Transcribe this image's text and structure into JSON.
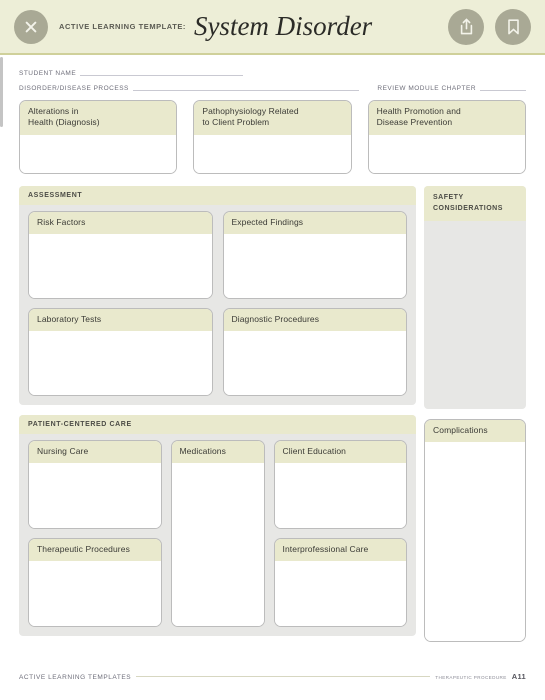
{
  "appbar": {
    "close_icon": "close-x-icon",
    "kicker": "ACTIVE LEARNING TEMPLATE:",
    "title": "System Disorder",
    "share_icon": "share-upload-icon",
    "bookmark_icon": "bookmark-icon",
    "background_color": "#edeed7",
    "button_color": "#a9a995",
    "rule_color": "#cfd09a"
  },
  "identity": {
    "student_name_label": "STUDENT NAME",
    "student_name_value": "",
    "student_name_placeholder": "",
    "disorder_label": "DISORDER/DISEASE PROCESS",
    "disorder_value": "",
    "disorder_placeholder": "",
    "chapter_label": "REVIEW MODULE CHAPTER",
    "chapter_value": "",
    "chapter_placeholder": ""
  },
  "top_boxes": [
    {
      "label": "Alterations in\nHealth (Diagnosis)",
      "value": "",
      "placeholder": ""
    },
    {
      "label": "Pathophysiology Related\nto Client Problem",
      "value": "",
      "placeholder": ""
    },
    {
      "label": "Health Promotion and\nDisease Prevention",
      "value": "",
      "placeholder": ""
    }
  ],
  "assessment": {
    "section_title": "ASSESSMENT",
    "boxes": [
      {
        "label": "Risk Factors",
        "value": "",
        "placeholder": ""
      },
      {
        "label": "Expected Findings",
        "value": "",
        "placeholder": ""
      },
      {
        "label": "Laboratory Tests",
        "value": "",
        "placeholder": ""
      },
      {
        "label": "Diagnostic Procedures",
        "value": "",
        "placeholder": ""
      }
    ]
  },
  "safety": {
    "section_title": "SAFETY CONSIDERATIONS",
    "value": "",
    "placeholder": ""
  },
  "patient_centered_care": {
    "section_title": "PATIENT-CENTERED CARE",
    "nursing_care": {
      "label": "Nursing Care",
      "value": "",
      "placeholder": ""
    },
    "therapeutic_procedures": {
      "label": "Therapeutic Procedures",
      "value": "",
      "placeholder": ""
    },
    "medications": {
      "label": "Medications",
      "value": "",
      "placeholder": ""
    },
    "client_education": {
      "label": "Client Education",
      "value": "",
      "placeholder": ""
    },
    "interprofessional_care": {
      "label": "Interprofessional Care",
      "value": "",
      "placeholder": ""
    }
  },
  "complications": {
    "label": "Complications",
    "value": "",
    "placeholder": ""
  },
  "footer": {
    "left": "ACTIVE LEARNING TEMPLATES",
    "category": "THERAPEUTIC PROCEDURE",
    "page": "A11"
  },
  "colors": {
    "sheet_background": "#ffffff",
    "card_header": "#e9e9cd",
    "panel_background": "#e7e7e5",
    "card_border": "#bcbcbc",
    "rule": "#c9c9d2",
    "text": "#3b3b36"
  }
}
